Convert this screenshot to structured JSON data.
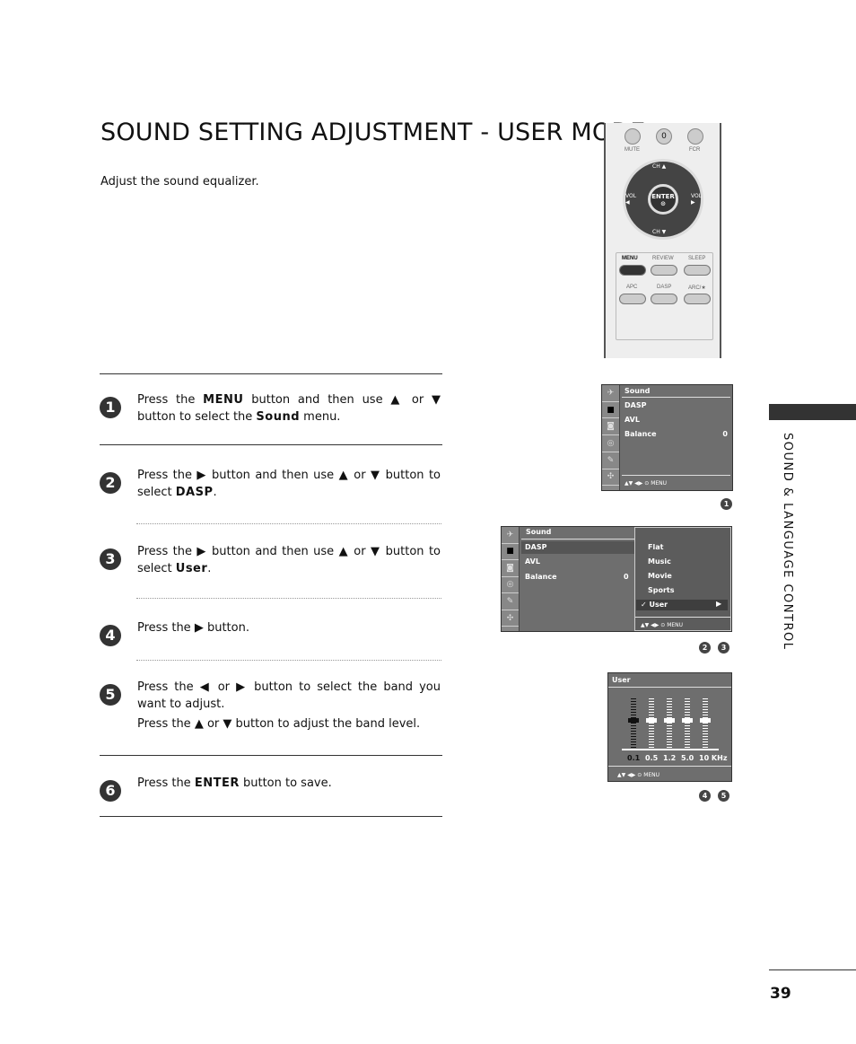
{
  "title": "SOUND SETTING ADJUSTMENT - USER MODE",
  "intro": "Adjust the sound equalizer.",
  "steps": [
    {
      "n": "1",
      "parts": [
        "Press the ",
        "MENU",
        " button and then use ",
        "▲",
        " or ",
        "▼",
        " button to select the ",
        "Sound",
        " menu."
      ]
    },
    {
      "n": "2",
      "parts": [
        "Press the ",
        "▶",
        " button and then use ",
        "▲",
        " or ",
        "▼",
        " button to select ",
        "DASP",
        "."
      ]
    },
    {
      "n": "3",
      "parts": [
        "Press the ",
        "▶",
        " button and then use ",
        "▲",
        " or ",
        "▼",
        " button to select ",
        "User",
        "."
      ]
    },
    {
      "n": "4",
      "parts": [
        "Press the ",
        "▶",
        " button."
      ]
    },
    {
      "n": "5",
      "parts": [
        "Press the ",
        "◀",
        " or ",
        "▶",
        " button to select the band you want to adjust."
      ],
      "parts2": [
        "Press the ",
        "▲",
        " or ",
        "▼",
        " button to adjust the band level."
      ]
    },
    {
      "n": "6",
      "parts": [
        "Press the ",
        "ENTER",
        " button to save."
      ]
    }
  ],
  "remote": {
    "mute": "MUTE",
    "zero": "0",
    "fcr": "FCR",
    "ch_up": "CH ▲",
    "ch_down": "CH ▼",
    "vol_left": "VOL ◀",
    "vol_right": "VOL ▶",
    "enter": "ENTER",
    "menu": "MENU",
    "review": "REVIEW",
    "sleep": "SLEEP",
    "apc": "APC",
    "dasp": "DASP",
    "arc": "ARC/★"
  },
  "menu1": {
    "title": "Sound",
    "items": [
      "DASP",
      "AVL",
      "Balance"
    ],
    "balance_value": "0",
    "footer": "▲▼  ◀▶  ⊙  MENU",
    "badge": "1"
  },
  "menu2": {
    "title": "Sound",
    "items": [
      "DASP",
      "AVL",
      "Balance"
    ],
    "balance_value": "0",
    "options": [
      "Flat",
      "Music",
      "Movie",
      "Sports",
      "✓ User"
    ],
    "arrow": "▶",
    "footer": "▲▼  ◀▶  ⊙  MENU",
    "badges": [
      "2",
      "3"
    ]
  },
  "menu3": {
    "title": "User",
    "bands": [
      "0.1",
      "0.5",
      "1.2",
      "5.0",
      "10 KHz"
    ],
    "levels": [
      0,
      0,
      0,
      0,
      0
    ],
    "footer": "▲▼  ◀▶  ⊙  MENU",
    "badges": [
      "4",
      "5"
    ]
  },
  "section": "SOUND & LANGUAGE CONTROL",
  "page_number": "39"
}
